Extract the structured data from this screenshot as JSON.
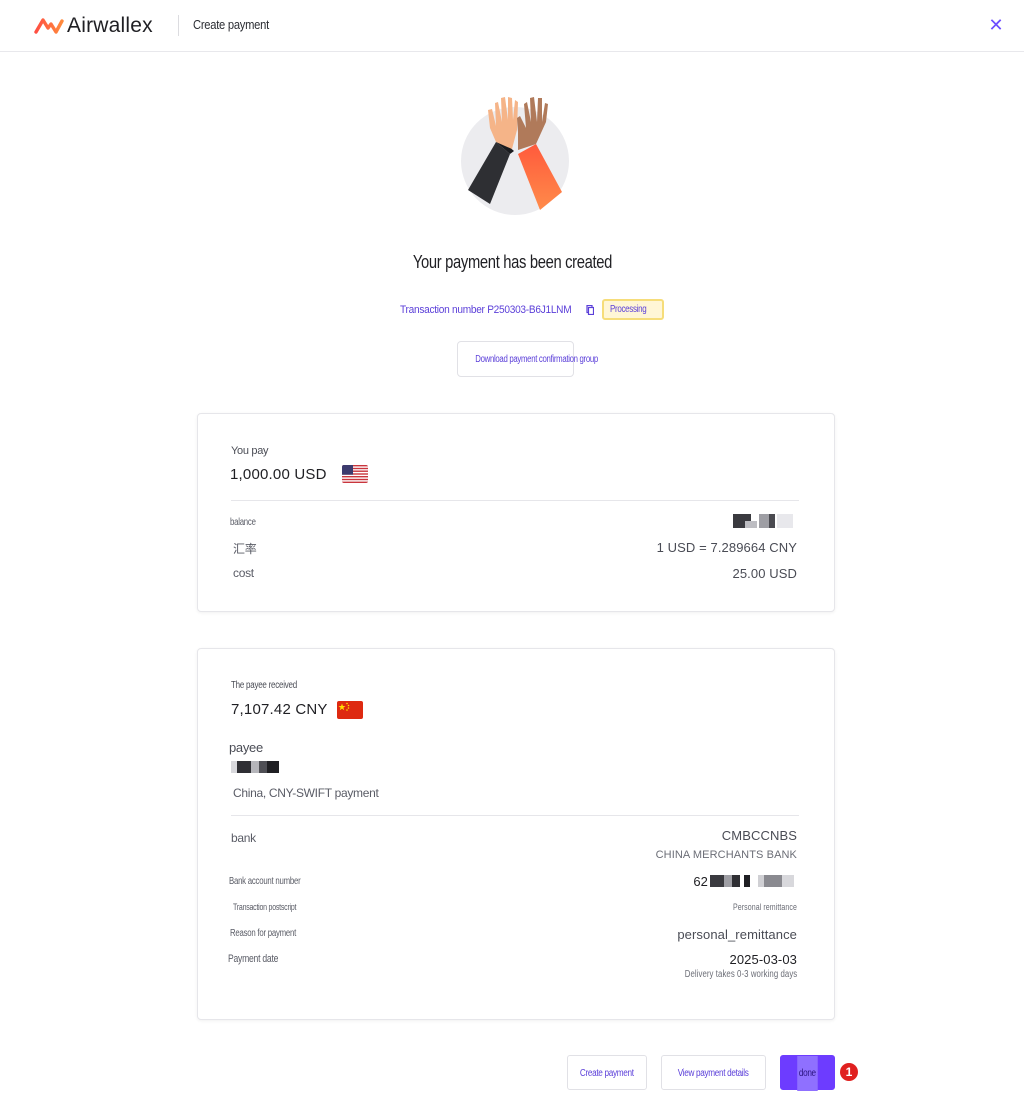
{
  "header": {
    "brand": "Airwallex",
    "title": "Create payment",
    "close_icon": "close-icon",
    "accent_color": "#6c4dff"
  },
  "status": {
    "headline": "Your payment has been created",
    "transaction_label": "Transaction number P250303-B6J1LNM",
    "badge": "Processing",
    "badge_color": "#f6dd7a",
    "download_label": "Download payment confirmation group"
  },
  "pay_card": {
    "label": "You pay",
    "amount": "1,000.00 USD",
    "flag": "us-flag",
    "rows": {
      "balance_label": "balance",
      "rate_label": "汇率",
      "rate_value": "1 USD = 7.289664 CNY",
      "cost_label": "cost",
      "cost_value": "25.00 USD"
    }
  },
  "recv_card": {
    "label": "The payee received",
    "amount": "7,107.42 CNY",
    "flag": "cn-flag",
    "payee_label": "payee",
    "payee_method": "China, CNY-SWIFT payment",
    "rows": {
      "bank_label": "bank",
      "bank_code": "CMBCCNBS",
      "bank_name": "CHINA MERCHANTS BANK",
      "account_label": "Bank account number",
      "account_prefix": "62",
      "postscript_label": "Transaction postscript",
      "postscript_value": "Personal remittance",
      "reason_label": "Reason for payment",
      "reason_value": "personal_remittance",
      "date_label": "Payment date",
      "date_value": "2025-03-03",
      "delivery_note": "Delivery takes 0-3 working days"
    }
  },
  "actions": {
    "create_label": "Create payment",
    "view_label": "View payment details",
    "done_label": "done",
    "step_number": "1",
    "primary_color": "#6d3cff"
  }
}
